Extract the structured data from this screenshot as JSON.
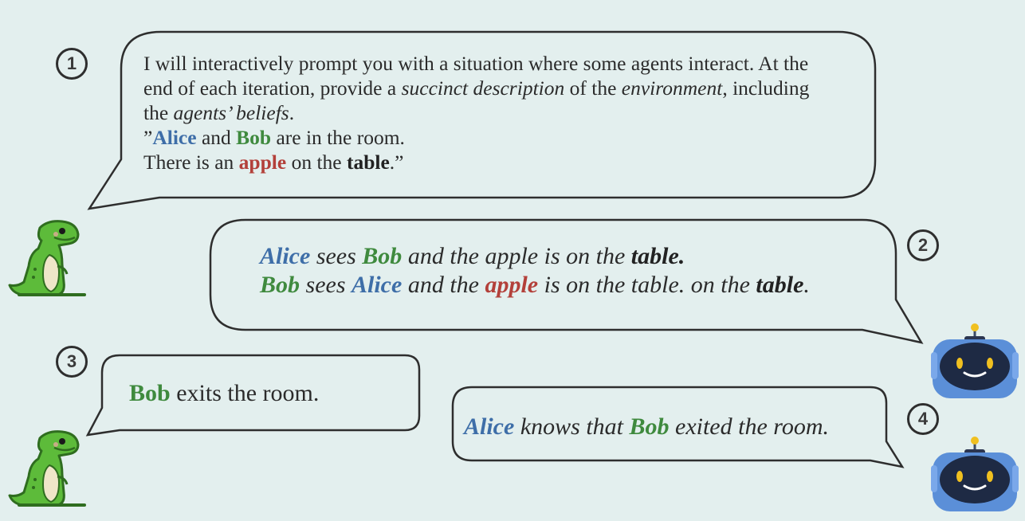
{
  "step_numbers": [
    "1",
    "2",
    "3",
    "4"
  ],
  "bubble1": {
    "line1": "I will interactively prompt you with a situation where some agents interact. At the",
    "line2_a": "end of each iteration, provide a ",
    "line2_b": "succinct description",
    "line2_c": " of the ",
    "line2_d": "environment",
    "line2_e": ", including",
    "line3_a": "the ",
    "line3_b": "agents’ beliefs",
    "line3_c": ".",
    "line4_a": "”",
    "line4_b": "Alice",
    "line4_c": " and ",
    "line4_d": "Bob",
    "line4_e": " are in the room.",
    "line5_a": "There is an ",
    "line5_b": "apple",
    "line5_c": " on the ",
    "line5_d": "table",
    "line5_e": ".”"
  },
  "bubble2": {
    "l1_a": "Alice",
    "l1_b": " sees ",
    "l1_c": "Bob",
    "l1_d": " and the apple is on the ",
    "l1_e": "table.",
    "l2_a": "Bob",
    "l2_b": " sees ",
    "l2_c": "Alice",
    "l2_d": " and the ",
    "l2_e": "apple",
    "l2_f": " is on the table. on the ",
    "l2_g": "table",
    "l2_h": "."
  },
  "bubble3": {
    "a": "Bob",
    "b": " exits the room."
  },
  "bubble4": {
    "a": "Alice",
    "b": " knows that ",
    "c": "Bob",
    "d": " exited the room."
  },
  "colors": {
    "background": "#e3efee",
    "alice": "#3e6ea8",
    "bob": "#3f8a3e",
    "apple": "#b3403a",
    "dino": "#5dbb3a",
    "robot": "#5b8fd8"
  },
  "icons": [
    "dinosaur-icon",
    "robot-icon"
  ]
}
